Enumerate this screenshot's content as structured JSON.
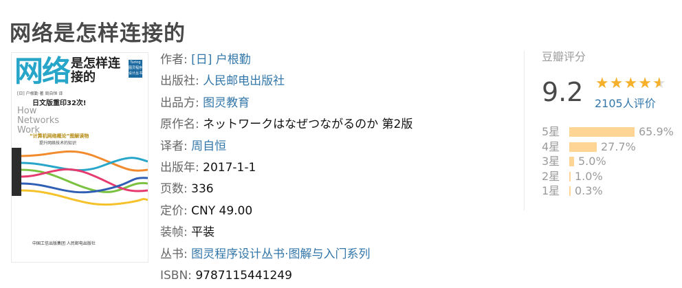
{
  "book": {
    "title": "网络是怎样连接的"
  },
  "cover": {
    "big": "网络",
    "sub": "是怎样连接的",
    "publisher_mark": "Turing 图灵程序设计丛书",
    "authors": "[日] 户根勤 著  周自恒 译",
    "reprint": "日文版重印32次!",
    "english": [
      "How",
      "Networks",
      "Work"
    ],
    "slogan": "“计算机网络概论”图解读物",
    "slogan2": "提升网络技术的知识",
    "logos": "中国工信出版集团   人民邮电出版社"
  },
  "info": [
    {
      "label": "作者:",
      "value": "[日] 户根勤",
      "link": true
    },
    {
      "label": "出版社:",
      "value": "人民邮电出版社",
      "link": true
    },
    {
      "label": "出品方:",
      "value": "图灵教育",
      "link": true
    },
    {
      "label": "原作名:",
      "value": "ネットワークはなぜつながるのか 第2版",
      "link": false
    },
    {
      "label": "译者:",
      "value": "周自恒",
      "link": true
    },
    {
      "label": "出版年:",
      "value": "2017-1-1",
      "link": false
    },
    {
      "label": "页数:",
      "value": "336",
      "link": false
    },
    {
      "label": "定价:",
      "value": "CNY 49.00",
      "link": false
    },
    {
      "label": "装帧:",
      "value": "平装",
      "link": false
    },
    {
      "label": "丛书:",
      "value": "图灵程序设计丛书·图解与入门系列",
      "link": true
    },
    {
      "label": "ISBN:",
      "value": "9787115441249",
      "link": false
    }
  ],
  "rating": {
    "title": "豆瓣评分",
    "score": "9.2",
    "stars": 4.5,
    "count_label": "2105人评价",
    "star_color": "#f6b02b",
    "bar_color": "#ffd596",
    "breakdown": [
      {
        "label": "5星",
        "pct": "65.9%",
        "value": 65.9
      },
      {
        "label": "4星",
        "pct": "27.7%",
        "value": 27.7
      },
      {
        "label": "3星",
        "pct": "5.0%",
        "value": 5.0
      },
      {
        "label": "2星",
        "pct": "1.0%",
        "value": 1.0
      },
      {
        "label": "1星",
        "pct": "0.3%",
        "value": 0.3
      }
    ]
  }
}
